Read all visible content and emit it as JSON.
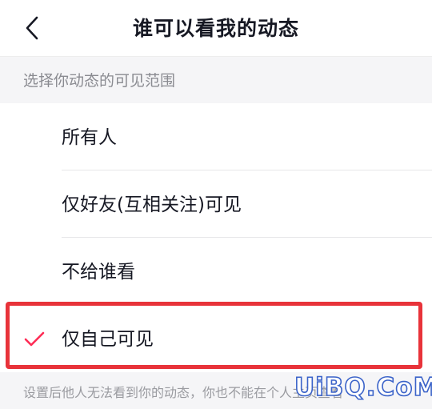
{
  "header": {
    "title": "谁可以看我的动态",
    "back_icon": "chevron-left-icon"
  },
  "section": {
    "label": "选择你动态的可见范围"
  },
  "options": [
    {
      "label": "所有人",
      "selected": false
    },
    {
      "label": "仅好友(互相关注)可见",
      "selected": false
    },
    {
      "label": "不给谁看",
      "selected": false
    },
    {
      "label": "仅自己可见",
      "selected": true
    }
  ],
  "footer": {
    "note": "设置后他人无法看到你的动态，你也不能在个人主页查看"
  },
  "watermark": {
    "text": "UiBQ.CoM"
  },
  "colors": {
    "accent": "#fe2c55",
    "highlight_border": "#e8333a",
    "watermark": "#3b63c9"
  }
}
